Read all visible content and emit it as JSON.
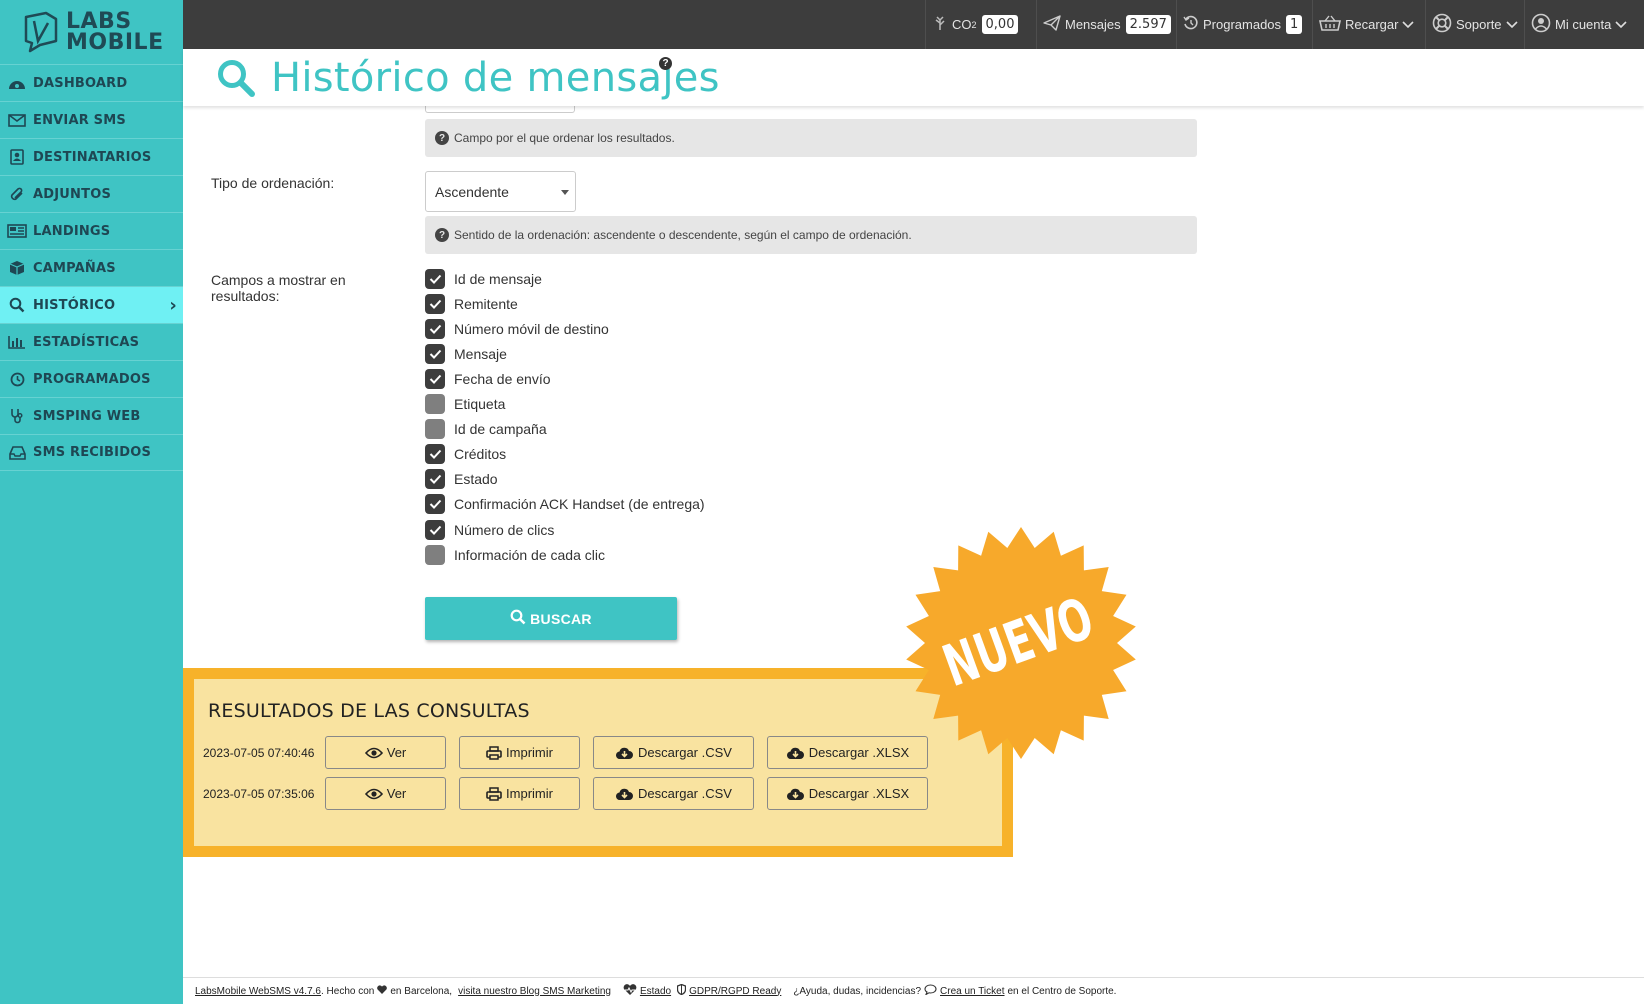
{
  "brand": {
    "line1": "LABS",
    "line2": "MOBILE"
  },
  "sidebar": {
    "items": [
      {
        "label": "DASHBOARD",
        "icon": "dashboard-icon"
      },
      {
        "label": "ENVIAR SMS",
        "icon": "envelope-icon"
      },
      {
        "label": "DESTINATARIOS",
        "icon": "contacts-icon"
      },
      {
        "label": "ADJUNTOS",
        "icon": "paperclip-icon"
      },
      {
        "label": "LANDINGS",
        "icon": "newspaper-icon"
      },
      {
        "label": "CAMPAÑAS",
        "icon": "box-icon"
      },
      {
        "label": "HISTÓRICO",
        "icon": "search-icon",
        "active": true
      },
      {
        "label": "ESTADÍSTICAS",
        "icon": "bar-chart-icon"
      },
      {
        "label": "PROGRAMADOS",
        "icon": "clock-icon"
      },
      {
        "label": "SMSPING WEB",
        "icon": "stethoscope-icon"
      },
      {
        "label": "SMS RECIBIDOS",
        "icon": "inbox-icon"
      }
    ]
  },
  "topbar": {
    "co2_label": "CO",
    "co2_sub": "2",
    "co2_value": "0,00",
    "mensajes_label": "Mensajes",
    "mensajes_value": "2.597",
    "programados_label": "Programados",
    "programados_value": "1",
    "recargar_label": "Recargar",
    "soporte_label": "Soporte",
    "cuenta_label": "Mi cuenta"
  },
  "page": {
    "title": "Histórico de mensajes",
    "help_mark": "?"
  },
  "form": {
    "order_field_hint": "Campo por el que ordenar los resultados.",
    "order_type_label": "Tipo de ordenación:",
    "order_type_value": "Ascendente",
    "order_type_hint": "Sentido de la ordenación: ascendente o descendente, según el campo de ordenación.",
    "fields_label": "Campos a mostrar en resultados:",
    "fields": [
      {
        "label": "Id de mensaje",
        "checked": true
      },
      {
        "label": "Remitente",
        "checked": true
      },
      {
        "label": "Número móvil de destino",
        "checked": true
      },
      {
        "label": "Mensaje",
        "checked": true
      },
      {
        "label": "Fecha de envío",
        "checked": true
      },
      {
        "label": "Etiqueta",
        "checked": false
      },
      {
        "label": "Id de campaña",
        "checked": false
      },
      {
        "label": "Créditos",
        "checked": true
      },
      {
        "label": "Estado",
        "checked": true
      },
      {
        "label": "Confirmación ACK Handset (de entrega)",
        "checked": true
      },
      {
        "label": "Número de clics",
        "checked": true
      },
      {
        "label": "Información de cada clic",
        "checked": false
      }
    ],
    "search_button": "BUSCAR"
  },
  "results": {
    "title": "RESULTADOS DE LAS CONSULTAS",
    "rows": [
      {
        "date": "2023-07-05 07:40:46",
        "ver": "Ver",
        "imprimir": "Imprimir",
        "csv": "Descargar .CSV",
        "xlsx": "Descargar .XLSX"
      },
      {
        "date": "2023-07-05 07:35:06",
        "ver": "Ver",
        "imprimir": "Imprimir",
        "csv": "Descargar .CSV",
        "xlsx": "Descargar .XLSX"
      }
    ]
  },
  "badge": {
    "text": "NUEVO",
    "color": "#f7a92b"
  },
  "footer": {
    "version": "LabsMobile WebSMS v4.7.6",
    "made_with": ". Hecho con",
    "in_city": "en Barcelona,",
    "blog": "visita nuestro Blog SMS Marketing",
    "estado": "Estado",
    "gdpr": "GDPR/RGPD Ready",
    "help_q": "¿Ayuda, dudas, incidencias?",
    "ticket": "Crea un Ticket",
    "support": "en el Centro de Soporte."
  },
  "colors": {
    "accent": "#3fc4c4",
    "topbar": "#3d3d3d",
    "results_border": "#f7b22a",
    "results_bg": "#f9e3a0"
  }
}
